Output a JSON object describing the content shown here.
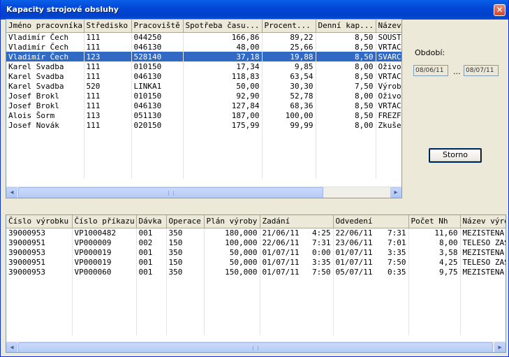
{
  "window": {
    "title": "Kapacity strojové obsluhy",
    "close_glyph": "✕"
  },
  "top_grid": {
    "columns": [
      "Jméno pracovníka",
      "Středisko",
      "Pracoviště",
      "Spotřeba času...",
      "Procent...",
      "Denní kap...",
      "Název"
    ],
    "rows": [
      [
        "Vladimír Čech",
        "111",
        "044250",
        "166,86",
        "89,22",
        "8,50",
        "SOUST"
      ],
      [
        "Vladimír Čech",
        "111",
        "046130",
        "48,00",
        "25,66",
        "8,50",
        "VRTAC"
      ],
      [
        "Vladimír Čech",
        "123",
        "528140",
        "37,18",
        "19,88",
        "8,50",
        "SVARC"
      ],
      [
        "Karel Svadba",
        "111",
        "010150",
        "17,34",
        "9,85",
        "8,00",
        "Oživo"
      ],
      [
        "Karel Svadba",
        "111",
        "046130",
        "118,83",
        "63,54",
        "8,50",
        "VRTAC"
      ],
      [
        "Karel Svadba",
        "520",
        "LINKA1",
        "50,00",
        "30,30",
        "7,50",
        "Výrob"
      ],
      [
        "Josef Brokl",
        "111",
        "010150",
        "92,90",
        "52,78",
        "8,00",
        "Oživo"
      ],
      [
        "Josef Brokl",
        "111",
        "046130",
        "127,84",
        "68,36",
        "8,50",
        "VRTAC"
      ],
      [
        "Alois Šorm",
        "113",
        "051130",
        "187,00",
        "100,00",
        "8,50",
        "FREZF"
      ],
      [
        "Josef Novák",
        "111",
        "020150",
        "175,99",
        "99,99",
        "8,00",
        "Zkuše"
      ]
    ],
    "selected_row": 2
  },
  "period": {
    "label": "Období:",
    "from": "08/06/11",
    "separator": "...",
    "to": "08/07/11"
  },
  "cancel_button": "Storno",
  "bottom_grid": {
    "columns": [
      "Číslo výrobku",
      "Číslo příkazu",
      "Dávka",
      "Operace",
      "Plán výroby",
      "Zadání",
      "Odvedení",
      "Počet Nh",
      "Název výro"
    ],
    "rows": [
      [
        "39000953",
        "VP1000482",
        "001",
        "350",
        "180,000",
        "21/06/11",
        "4:25",
        "22/06/11",
        "7:31",
        "11,60",
        "MEZISTENA"
      ],
      [
        "39000951",
        "VP000009",
        "002",
        "150",
        "100,000",
        "22/06/11",
        "7:31",
        "23/06/11",
        "7:01",
        "8,00",
        "TELESO ZAS"
      ],
      [
        "39000953",
        "VP000019",
        "001",
        "350",
        "50,000",
        "01/07/11",
        "0:00",
        "01/07/11",
        "3:35",
        "3,58",
        "MEZISTENA"
      ],
      [
        "39000951",
        "VP000019",
        "001",
        "150",
        "50,000",
        "01/07/11",
        "3:35",
        "01/07/11",
        "7:50",
        "4,25",
        "TELESO ZAS"
      ],
      [
        "39000953",
        "VP000060",
        "001",
        "350",
        "150,000",
        "01/07/11",
        "7:50",
        "05/07/11",
        "0:35",
        "9,75",
        "MEZISTENA"
      ]
    ]
  }
}
